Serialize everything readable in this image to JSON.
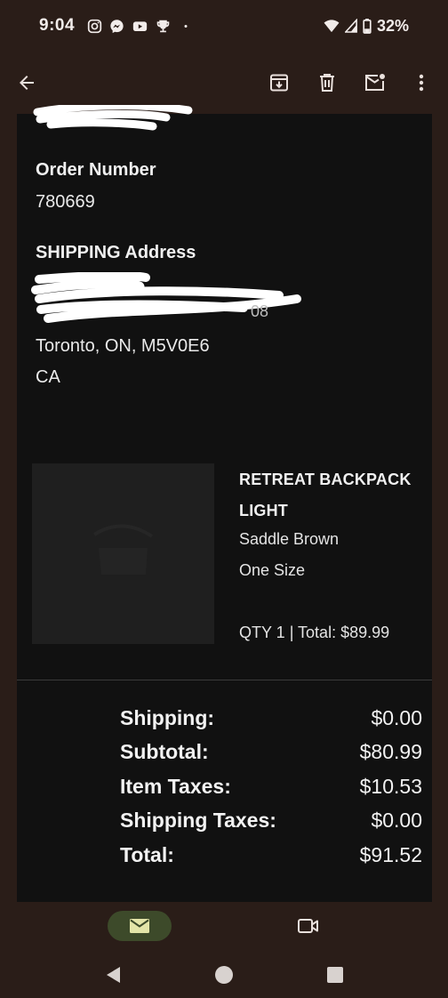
{
  "status_bar": {
    "time": "9:04",
    "battery": "32%",
    "notification_icons": [
      "instagram-icon",
      "messenger-icon",
      "youtube-icon",
      "trophy-icon",
      "dot-icon"
    ]
  },
  "app_bar": {
    "actions": [
      "back-arrow-icon",
      "archive-icon",
      "delete-icon",
      "mark-unread-icon",
      "more-vert-icon"
    ]
  },
  "email": {
    "order_number_label": "Order Number",
    "order_number": "780669",
    "shipping_label": "SHIPPING Address",
    "address_line_city": "Toronto, ON, M5V0E6",
    "address_country": "CA",
    "address_partial": "08",
    "product": {
      "name": "RETREAT BACKPACK LIGHT",
      "color": "Saddle Brown",
      "size": "One Size",
      "qty_total": "QTY 1 | Total: $89.99"
    },
    "totals": [
      {
        "label": "Shipping:",
        "value": "$0.00"
      },
      {
        "label": "Subtotal:",
        "value": "$80.99"
      },
      {
        "label": "Item Taxes:",
        "value": "$10.53"
      },
      {
        "label": "Shipping Taxes:",
        "value": "$0.00"
      },
      {
        "label": "Total:",
        "value": "$91.52"
      }
    ]
  },
  "bottom_nav": {
    "items": [
      "mail-icon",
      "video-icon"
    ]
  },
  "colors": {
    "background": "#2a1d18",
    "content_bg": "#111111",
    "mail_pill": "#3d4a2a",
    "mail_icon": "#e3e4a8"
  }
}
